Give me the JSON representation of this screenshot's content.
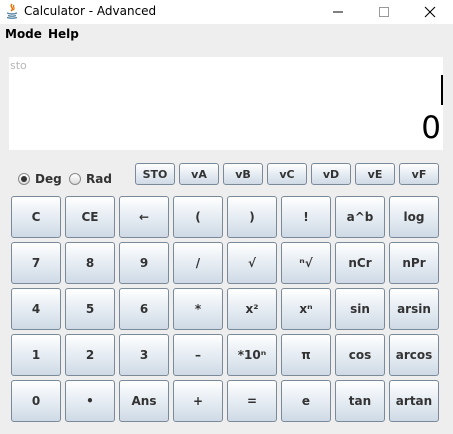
{
  "window": {
    "title": "Calculator - Advanced",
    "minimize_glyph": "–",
    "maximize_glyph": "☐",
    "close_glyph": "✕",
    "icon": "java-icon"
  },
  "menubar": {
    "items": [
      "Mode",
      "Help"
    ]
  },
  "display": {
    "memory_text": "sto",
    "result": "0"
  },
  "angle_mode": {
    "options": [
      "Deg",
      "Rad"
    ],
    "selected": "Deg"
  },
  "memory_buttons": [
    "STO",
    "vA",
    "vB",
    "vC",
    "vD",
    "vE",
    "vF"
  ],
  "keypad": [
    [
      "C",
      "CE",
      "←",
      "(",
      ")",
      "!",
      "a^b",
      "log"
    ],
    [
      "7",
      "8",
      "9",
      "/",
      "√",
      "ⁿ√",
      "nCr",
      "nPr"
    ],
    [
      "4",
      "5",
      "6",
      "*",
      "x²",
      "xⁿ",
      "sin",
      "arsin"
    ],
    [
      "1",
      "2",
      "3",
      "–",
      "*10ⁿ",
      "π",
      "cos",
      "arcos"
    ],
    [
      "0",
      "•",
      "Ans",
      "+",
      "=",
      "e",
      "tan",
      "artan"
    ]
  ]
}
